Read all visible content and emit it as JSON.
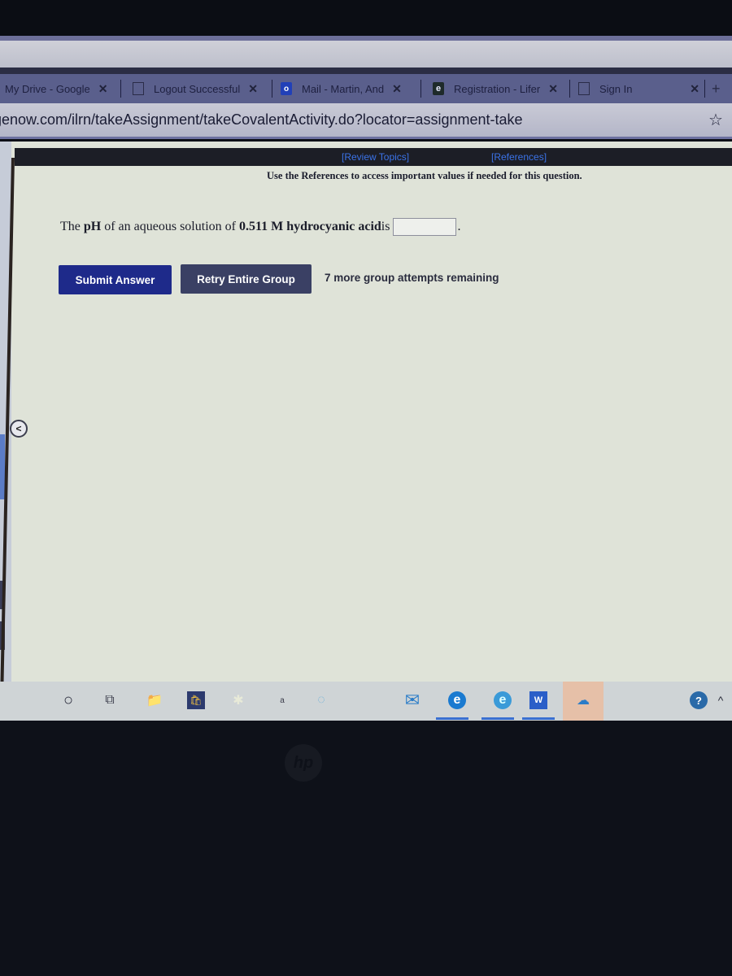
{
  "browser": {
    "tabs": [
      {
        "label": "My Drive - Google",
        "favicon": "google-drive-icon",
        "close": "✕"
      },
      {
        "label": "Logout Successful",
        "favicon": "document-icon",
        "close": "✕"
      },
      {
        "label": "Mail - Martin, And",
        "favicon": "outlook-icon",
        "close": "✕"
      },
      {
        "label": "Registration - Lifer",
        "favicon": "e-icon",
        "close": "✕"
      },
      {
        "label": "Sign In",
        "favicon": "document-icon",
        "close": "✕"
      }
    ],
    "new_tab": "+",
    "url": "genow.com/ilrn/takeAssignment/takeCovalentActivity.do?locator=assignment-take",
    "bookmark_icon": "☆"
  },
  "page": {
    "links": {
      "review_topics": "[Review Topics]",
      "references": "[References]"
    },
    "instructions": "Use the References to access important values if needed for this question.",
    "question": {
      "prefix": "The ",
      "ph": "pH",
      "middle": " of an aqueous solution of ",
      "concentration": "0.511 M hydrocyanic acid",
      "suffix": " is",
      "answer_value": "",
      "end": "."
    },
    "buttons": {
      "submit": "Submit Answer",
      "retry": "Retry Entire Group"
    },
    "attempts_text": "7 more group attempts remaining",
    "collapse_glyph": "<"
  },
  "taskbar": {
    "icons": [
      {
        "name": "search-icon",
        "glyph": "○"
      },
      {
        "name": "task-view-icon",
        "glyph": "⧉"
      },
      {
        "name": "file-explorer-icon",
        "glyph": "📁"
      },
      {
        "name": "microsoft-store-icon",
        "glyph": "🛍"
      },
      {
        "name": "faded-app-icon",
        "glyph": "✱"
      },
      {
        "name": "small-app-icon",
        "glyph": "a"
      },
      {
        "name": "faded-app-2-icon",
        "glyph": "◌"
      },
      {
        "name": "mail-icon",
        "glyph": "✉"
      },
      {
        "name": "edge-icon",
        "glyph": "e"
      },
      {
        "name": "edge-beta-icon",
        "glyph": "e"
      },
      {
        "name": "word-icon",
        "glyph": "W"
      },
      {
        "name": "onedrive-icon",
        "glyph": "☁"
      }
    ],
    "tray": {
      "help_glyph": "?",
      "chevron_glyph": "^"
    }
  },
  "device": {
    "logo": "hp"
  }
}
